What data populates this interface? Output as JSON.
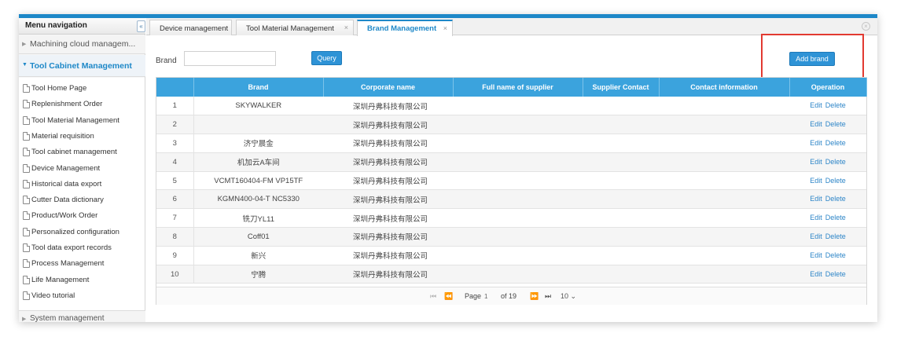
{
  "sidebar": {
    "title": "Menu navigation",
    "collapse_icon": "«",
    "group_machining": "Machining cloud managem...",
    "group_tool_cabinet": "Tool Cabinet Management",
    "items": [
      "Tool Home Page",
      "Replenishment Order",
      "Tool Material Management",
      "Material requisition",
      "Tool cabinet management",
      "Device Management",
      "Historical data export",
      "Cutter Data dictionary",
      "Product/Work Order",
      "Personalized configuration",
      "Tool data export records",
      "Process Management",
      "Life Management",
      "Video tutorial"
    ],
    "group_system": "System management"
  },
  "tabs": {
    "tab1": "Device management",
    "tab2": "Tool Material Management",
    "tab3": "Brand Management",
    "close_glyph": "×"
  },
  "toolbar": {
    "brand_label": "Brand",
    "brand_value": "",
    "query_label": "Query",
    "add_label": "Add brand"
  },
  "table": {
    "headers": {
      "brand": "Brand",
      "corporate": "Corporate name",
      "supplier": "Full name of supplier",
      "contact": "Supplier Contact",
      "info": "Contact information",
      "operation": "Operation"
    },
    "edit_label": "Edit",
    "delete_label": "Delete",
    "rows": [
      {
        "num": "1",
        "brand": "SKYWALKER",
        "corp": "深圳丹弗科技有限公司",
        "supplier": "",
        "contact": "",
        "info": ""
      },
      {
        "num": "2",
        "brand": "",
        "corp": "深圳丹弗科技有限公司",
        "supplier": "",
        "contact": "",
        "info": ""
      },
      {
        "num": "3",
        "brand": "济宁晨金",
        "corp": "深圳丹弗科技有限公司",
        "supplier": "",
        "contact": "",
        "info": ""
      },
      {
        "num": "4",
        "brand": "机加云A车间",
        "corp": "深圳丹弗科技有限公司",
        "supplier": "",
        "contact": "",
        "info": ""
      },
      {
        "num": "5",
        "brand": "VCMT160404-FM VP15TF",
        "corp": "深圳丹弗科技有限公司",
        "supplier": "",
        "contact": "",
        "info": ""
      },
      {
        "num": "6",
        "brand": "KGMN400-04-T NC5330",
        "corp": "深圳丹弗科技有限公司",
        "supplier": "",
        "contact": "",
        "info": ""
      },
      {
        "num": "7",
        "brand": "铣刀YL11",
        "corp": "深圳丹弗科技有限公司",
        "supplier": "",
        "contact": "",
        "info": ""
      },
      {
        "num": "8",
        "brand": "Coff01",
        "corp": "深圳丹弗科技有限公司",
        "supplier": "",
        "contact": "",
        "info": ""
      },
      {
        "num": "9",
        "brand": "新兴",
        "corp": "深圳丹弗科技有限公司",
        "supplier": "",
        "contact": "",
        "info": ""
      },
      {
        "num": "10",
        "brand": "宁腾",
        "corp": "深圳丹弗科技有限公司",
        "supplier": "",
        "contact": "",
        "info": ""
      }
    ]
  },
  "pager": {
    "page_label": "Page",
    "page_value": "1",
    "of_label": "of 19",
    "page_size": "10 ⌄",
    "first_icon": "⏮",
    "prev_icon": "⏪",
    "next_icon": "⏩",
    "last_icon": "⏭"
  },
  "colors": {
    "accent": "#1e88c8",
    "header_blue": "#3ba3dd",
    "highlight_red": "#e23a31"
  }
}
